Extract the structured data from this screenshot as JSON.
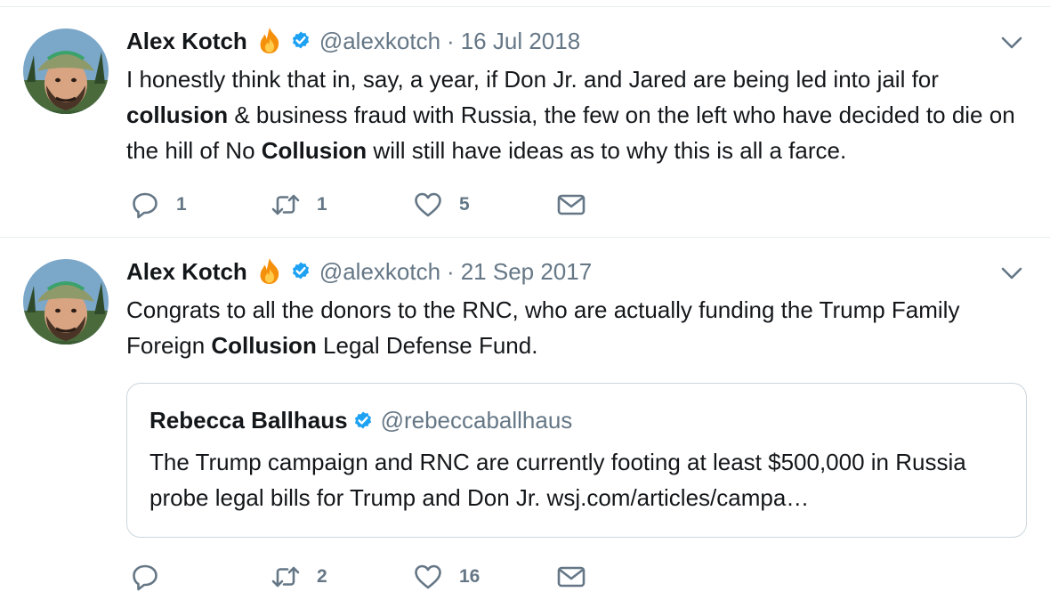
{
  "tweets": [
    {
      "author": {
        "name": "Alex Kotch",
        "handle": "@alexkotch",
        "verified": true
      },
      "separator": "·",
      "date": "16 Jul 2018",
      "text": {
        "p1": "I honestly think that in, say, a year, if Don Jr. and Jared are being led into jail for ",
        "b1": "collusion",
        "p2": " & business fraud with Russia, the few on the left who have decided to die on the hill of No ",
        "b2": "Collusion",
        "p3": " will still have ideas as to why this is all a farce."
      },
      "actions": {
        "replies": "1",
        "retweets": "1",
        "likes": "5"
      }
    },
    {
      "author": {
        "name": "Alex Kotch",
        "handle": "@alexkotch",
        "verified": true
      },
      "separator": "·",
      "date": "21 Sep 2017",
      "text": {
        "p1": "Congrats to all the donors to the RNC, who are actually funding the Trump Family Foreign ",
        "b1": "Collusion",
        "p2": " Legal Defense Fund."
      },
      "quoted": {
        "name": "Rebecca Ballhaus",
        "handle": "@rebeccaballhaus",
        "verified": true,
        "text": "The Trump campaign and RNC are currently footing at least $500,000 in Russia probe legal bills for Trump and Don Jr. wsj.com/articles/campa…"
      },
      "actions": {
        "replies": "",
        "retweets": "2",
        "likes": "16"
      }
    }
  ],
  "icons": {
    "reply": "reply-icon",
    "retweet": "retweet-icon",
    "like": "heart-icon",
    "dm": "envelope-icon",
    "caret": "chevron-down-icon",
    "verified": "verified-badge-icon",
    "emoji": "fire-emoji-icon"
  },
  "colors": {
    "text": "#14171a",
    "secondary": "#657786",
    "verified": "#1da1f2",
    "border": "#e6ecf0",
    "quote_border": "#ccd6dd"
  }
}
